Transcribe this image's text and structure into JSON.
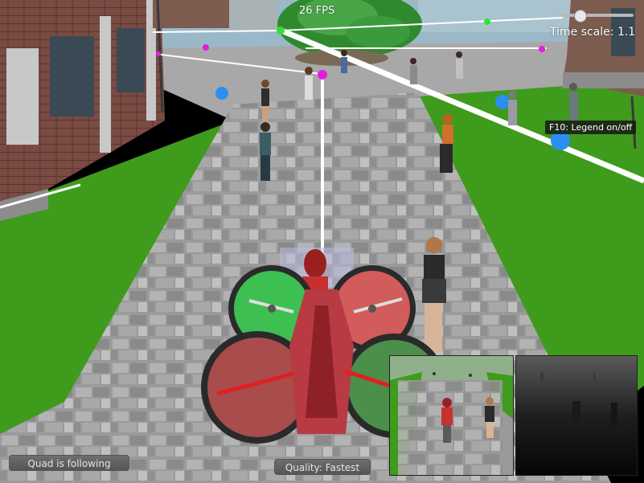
{
  "hud": {
    "fps": "26 FPS",
    "time_scale_label": "Time scale: 1.1",
    "time_scale_value": 1.1,
    "time_scale_fraction": 0.25,
    "legend_hint": "F10: Legend on/off"
  },
  "buttons": {
    "status": "Quad is following",
    "quality": "Quality: Fastest"
  },
  "colors": {
    "sky": "#9bb8c8",
    "grass": "#3f9b1c",
    "path": "#9a9a9a",
    "rotor_green": "#3fcf55",
    "rotor_red": "#e46060",
    "drone_body": "#b83a42",
    "waypoint_green": "#33e033",
    "waypoint_magenta": "#e020e0",
    "marker_blue": "#2a8ff0"
  },
  "icons": {
    "drone": "quadcopter-icon",
    "waypoint": "waypoint-dot-icon",
    "marker": "sphere-marker-icon"
  }
}
